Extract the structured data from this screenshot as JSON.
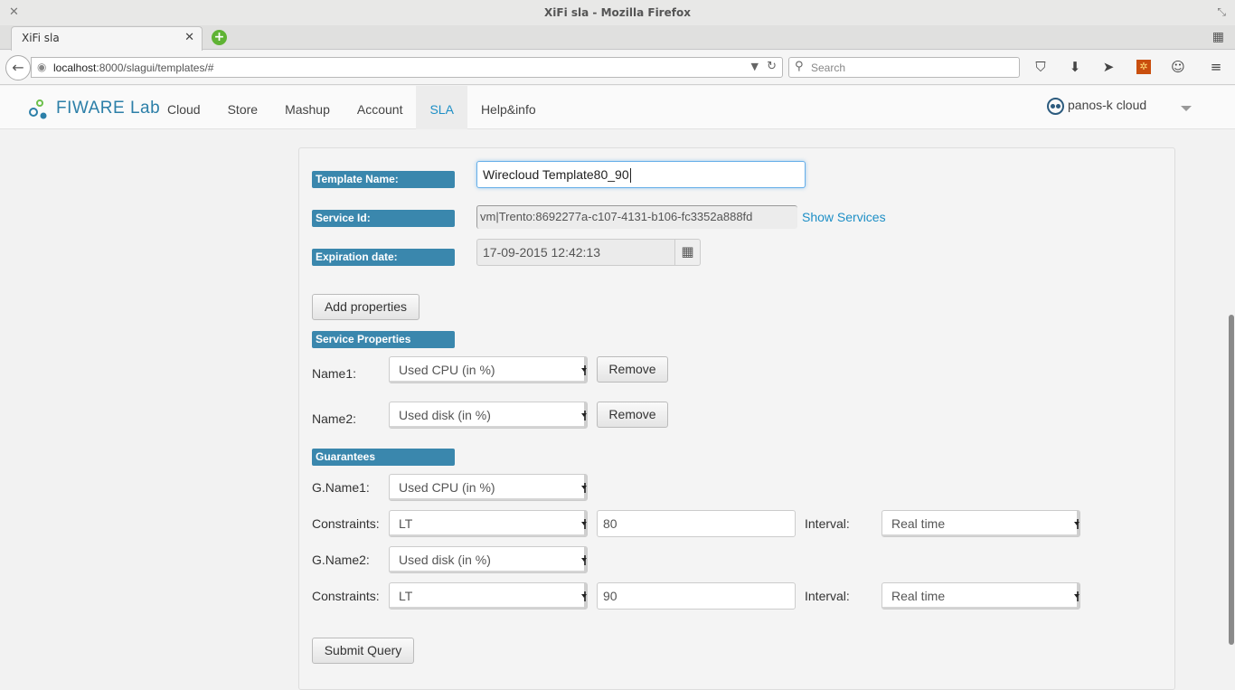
{
  "window": {
    "title": "XiFi sla - Mozilla Firefox"
  },
  "tab": {
    "label": "XiFi sla"
  },
  "navbar": {
    "url_host": "localhost",
    "url_rest": ":8000/slagui/templates/#",
    "search_placeholder": "Search"
  },
  "header": {
    "logo_fi": "FI",
    "logo_ware": "WARE",
    "logo_lab": "Lab",
    "menu": [
      "Cloud",
      "Store",
      "Mashup",
      "Account",
      "SLA",
      "Help&info"
    ],
    "active_menu": "SLA",
    "user": "panos-k cloud"
  },
  "form": {
    "template_name_label": "Template Name:",
    "template_name_value": "Wirecloud Template80_90",
    "service_id_label": "Service Id:",
    "service_id_value": "vm|Trento:8692277a-c107-4131-b106-fc3352a888fd",
    "show_services": "Show Services",
    "expiration_label": "Expiration date:",
    "expiration_value": "17-09-2015 12:42:13",
    "add_properties": "Add properties",
    "service_properties_label": "Service Properties",
    "properties": [
      {
        "name_label": "Name1:",
        "value": "Used CPU (in %)",
        "remove": "Remove"
      },
      {
        "name_label": "Name2:",
        "value": "Used disk (in %)",
        "remove": "Remove"
      }
    ],
    "guarantees_label": "Guarantees",
    "guarantees": [
      {
        "name_label": "G.Name1:",
        "value": "Used CPU (in %)",
        "constraints_label": "Constraints:",
        "operator": "LT",
        "threshold": "80",
        "interval_label": "Interval:",
        "interval": "Real time"
      },
      {
        "name_label": "G.Name2:",
        "value": "Used disk (in %)",
        "constraints_label": "Constraints:",
        "operator": "LT",
        "threshold": "90",
        "interval_label": "Interval:",
        "interval": "Real time"
      }
    ],
    "submit": "Submit Query"
  }
}
